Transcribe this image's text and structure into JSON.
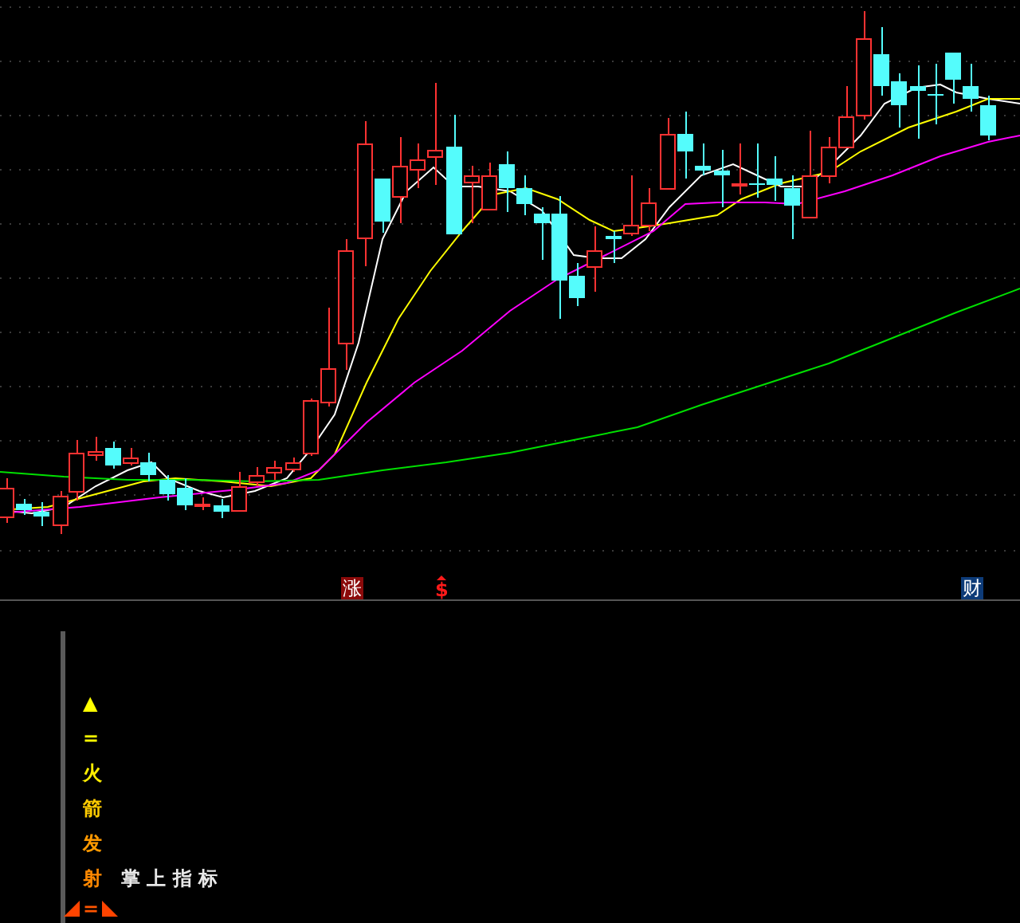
{
  "price_chart": {
    "signals": [
      {
        "kind": "badge",
        "text": "涨",
        "color": "#8b0a0a"
      },
      {
        "kind": "dollar",
        "text": "$",
        "color": "#ff1a1a"
      },
      {
        "kind": "badge",
        "text": "财",
        "color": "#0d3b78"
      }
    ]
  },
  "indicator_panel": {
    "column": [
      {
        "text": "▲",
        "color": "#ffff00"
      },
      {
        "text": "=",
        "color": "#ffff00"
      },
      {
        "text": "火",
        "color": "#ffee00"
      },
      {
        "text": "箭",
        "color": "#ffcc00"
      },
      {
        "text": "发",
        "color": "#ff9900"
      },
      {
        "text": "射",
        "color": "#ff8800"
      }
    ],
    "title": "掌 上 指 标",
    "bottom_mark": "="
  }
}
